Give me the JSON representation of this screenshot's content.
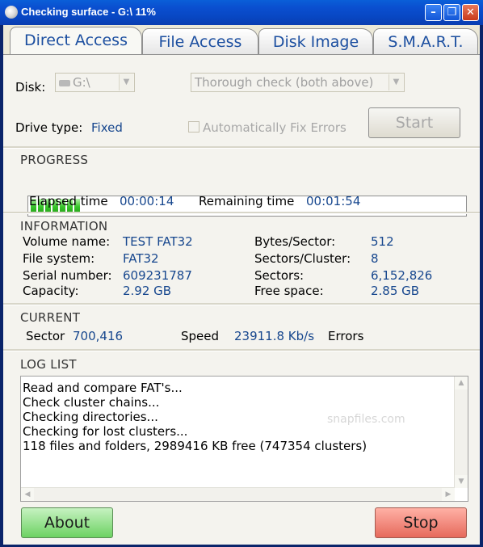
{
  "window": {
    "title": "Checking surface - G:\\ 11%",
    "minimize_glyph": "–",
    "maximize_glyph": "❐",
    "close_glyph": "✕"
  },
  "tabs": [
    {
      "label": "Direct Access",
      "active": true
    },
    {
      "label": "File Access"
    },
    {
      "label": "Disk Image"
    },
    {
      "label": "S.M.A.R.T."
    }
  ],
  "disk": {
    "label": "Disk:",
    "selected": "G:\\",
    "check_mode": "Thorough check (both above)",
    "drive_type_label": "Drive type:",
    "drive_type": "Fixed",
    "auto_fix_label": "Automatically Fix Errors",
    "start_label": "Start"
  },
  "progress": {
    "title": "PROGRESS",
    "percent": 11,
    "elapsed_label": "Elapsed time",
    "elapsed": "00:00:14",
    "remaining_label": "Remaining time",
    "remaining": "00:01:54"
  },
  "information": {
    "title": "INFORMATION",
    "volume_name_label": "Volume name:",
    "volume_name": "TEST FAT32",
    "file_system_label": "File system:",
    "file_system": "FAT32",
    "serial_label": "Serial number:",
    "serial": "609231787",
    "capacity_label": "Capacity:",
    "capacity": "2.92 GB",
    "bytes_sector_label": "Bytes/Sector:",
    "bytes_sector": "512",
    "sectors_cluster_label": "Sectors/Cluster:",
    "sectors_cluster": "8",
    "sectors_label": "Sectors:",
    "sectors": "6,152,826",
    "free_space_label": "Free space:",
    "free_space": "2.85 GB"
  },
  "current": {
    "title": "CURRENT",
    "sector_label": "Sector",
    "sector": "700,416",
    "speed_label": "Speed",
    "speed": "23911.8 Kb/s",
    "errors_label": "Errors"
  },
  "log": {
    "title": "LOG LIST",
    "lines": [
      "Read and compare FAT's...",
      "Check cluster chains...",
      "Checking directories...",
      "Checking for lost clusters...",
      "118 files and folders, 2989416 KB free (747354 clusters)"
    ],
    "watermark": "snapfiles.com"
  },
  "buttons": {
    "about": "About",
    "stop": "Stop"
  },
  "icons": {
    "app": "disk-check-icon",
    "drive": "drive-icon",
    "dropdown": "chevron-down-icon"
  },
  "colors": {
    "titlebar": "#0a4fd0",
    "value_text": "#17478e",
    "progress_green": "#37c42a",
    "about_green": "#6dd263",
    "stop_red": "#e66a5c"
  }
}
